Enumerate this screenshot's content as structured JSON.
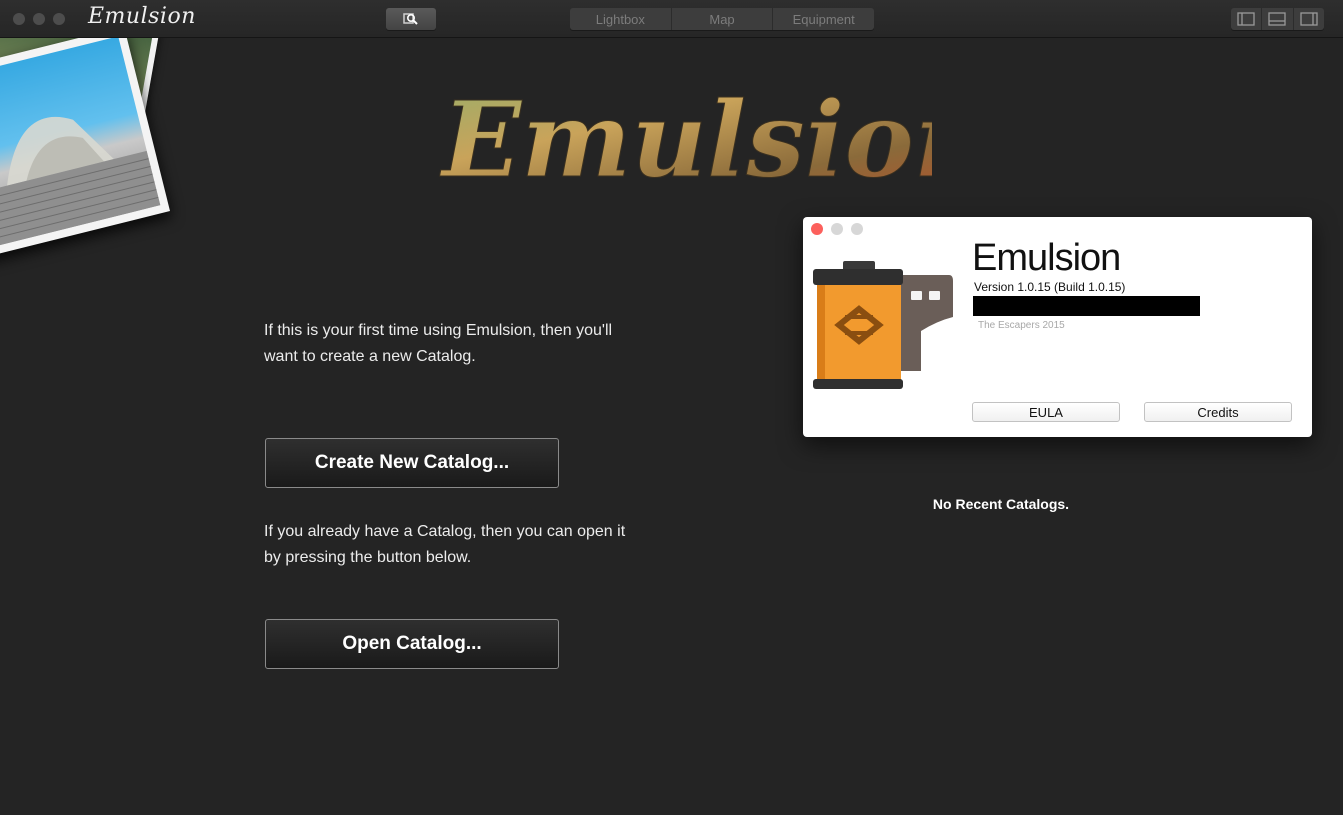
{
  "window": {
    "app_name": "Emulsion",
    "traffic_colors": [
      "#4d4d4d",
      "#4d4d4d",
      "#4d4d4d"
    ]
  },
  "toolbar": {
    "search_icon": "search-icon",
    "tabs": [
      {
        "label": "Lightbox"
      },
      {
        "label": "Map"
      },
      {
        "label": "Equipment"
      }
    ],
    "view_icons": [
      "sidebar-left-icon",
      "panel-bottom-icon",
      "sidebar-right-icon"
    ]
  },
  "main": {
    "logo_text": "Emulsion",
    "intro_new": "If this is your first time using Emulsion, then you'll want to create a new Catalog.",
    "create_button": "Create New Catalog...",
    "intro_open": "If you already have a Catalog, then you can open it by pressing the button below.",
    "open_button": "Open Catalog...",
    "recent_catalogs": "No Recent Catalogs."
  },
  "about": {
    "title": "Emulsion",
    "version": "Version 1.0.15 (Build 1.0.15)",
    "copyright": "The Escapers 2015",
    "eula_button": "EULA",
    "credits_button": "Credits",
    "dot_colors": [
      "#fc605c",
      "#d7d7d7",
      "#d7d7d7"
    ],
    "accent_color": "#f29a2e"
  }
}
